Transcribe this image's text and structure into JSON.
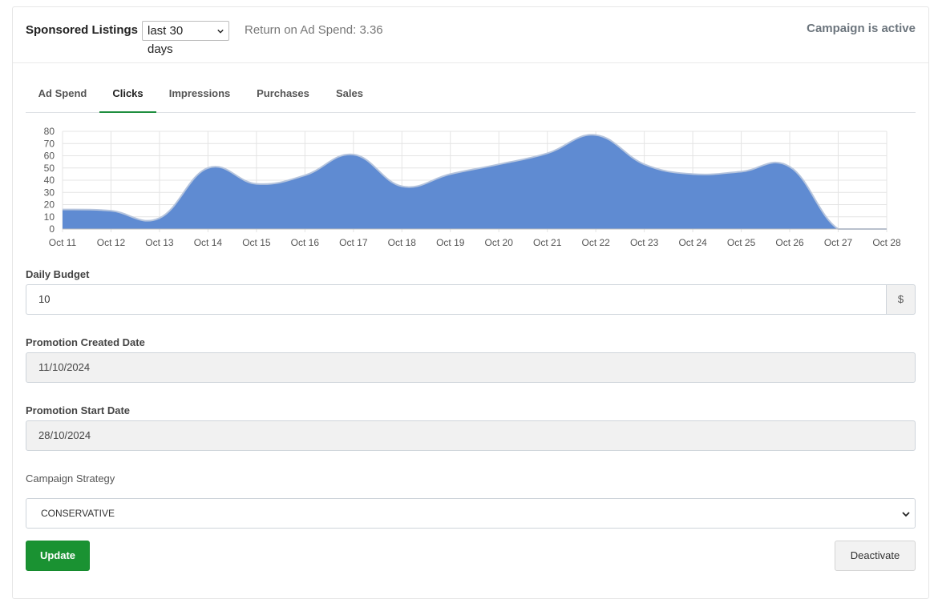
{
  "header": {
    "title": "Sponsored Listings",
    "period_selected": "last 30 days",
    "roas_text": "Return on Ad Spend: 3.36",
    "status": "Campaign is active"
  },
  "tabs": [
    {
      "label": "Ad Spend",
      "active": false
    },
    {
      "label": "Clicks",
      "active": true
    },
    {
      "label": "Impressions",
      "active": false
    },
    {
      "label": "Purchases",
      "active": false
    },
    {
      "label": "Sales",
      "active": false
    }
  ],
  "chart_data": {
    "type": "area",
    "x": [
      "Oct 11",
      "Oct 12",
      "Oct 13",
      "Oct 14",
      "Oct 15",
      "Oct 16",
      "Oct 17",
      "Oct 18",
      "Oct 19",
      "Oct 20",
      "Oct 21",
      "Oct 22",
      "Oct 23",
      "Oct 24",
      "Oct 25",
      "Oct 26",
      "Oct 27",
      "Oct 28"
    ],
    "series": [
      {
        "values": [
          16,
          15,
          9,
          50,
          37,
          44,
          61,
          35,
          45,
          53,
          62,
          77,
          53,
          45,
          47,
          51,
          0,
          0
        ]
      }
    ],
    "ylim": [
      0,
      80
    ],
    "yticks": [
      0,
      10,
      20,
      30,
      40,
      50,
      60,
      70,
      80
    ],
    "grid": true,
    "fill_color": "#5f8bd2",
    "line_color": "#b5c4dd"
  },
  "form": {
    "daily_budget": {
      "label": "Daily Budget",
      "value": "10",
      "addon": "$"
    },
    "created_date": {
      "label": "Promotion Created Date",
      "value": "11/10/2024"
    },
    "start_date": {
      "label": "Promotion Start Date",
      "value": "28/10/2024"
    },
    "strategy": {
      "label": "Campaign Strategy",
      "value": "CONSERVATIVE"
    }
  },
  "buttons": {
    "update": "Update",
    "deactivate": "Deactivate"
  },
  "colors": {
    "accent": "#1a9232",
    "tab_underline": "#1e8e3e"
  }
}
